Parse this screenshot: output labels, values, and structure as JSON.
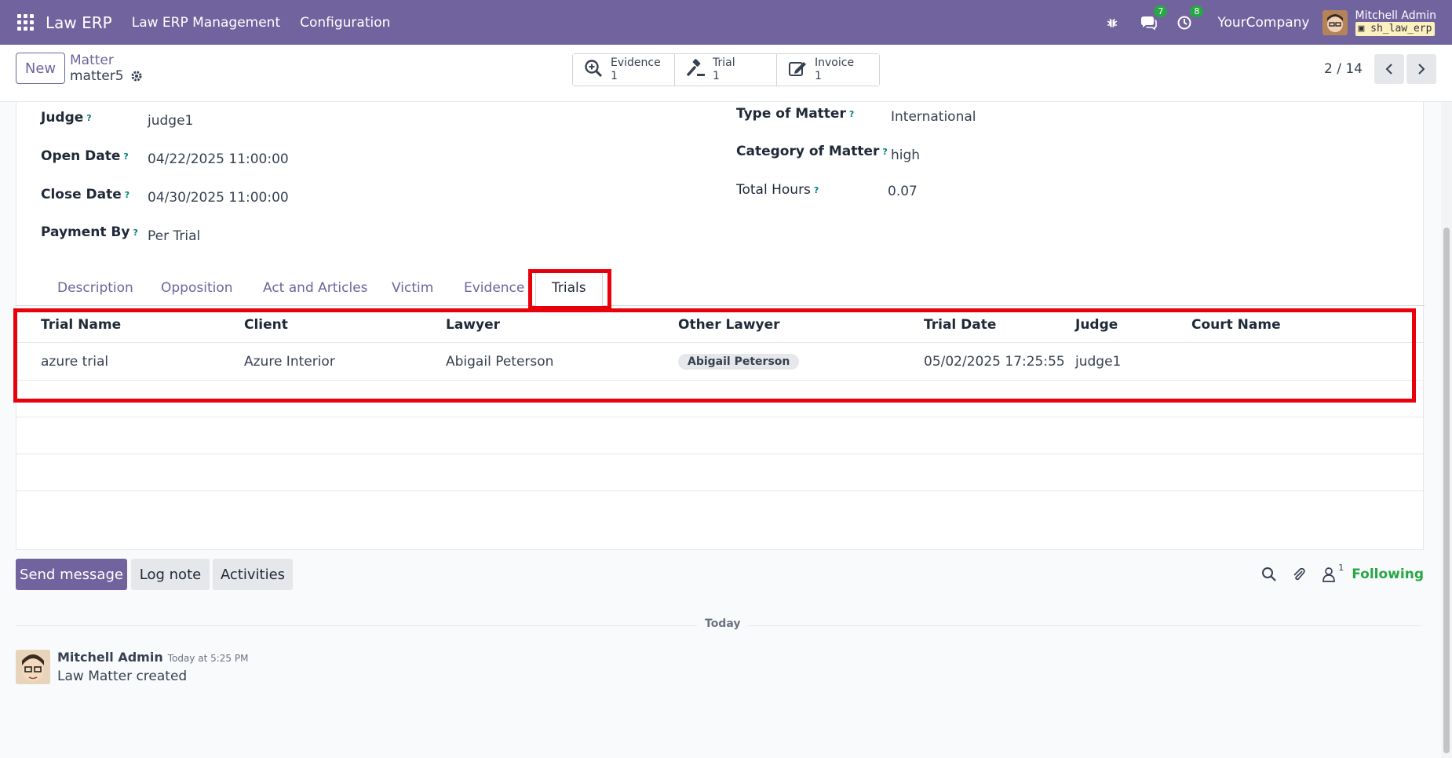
{
  "topbar": {
    "brand": "Law ERP",
    "menu": [
      "Law ERP Management",
      "Configuration"
    ],
    "messages_count": "7",
    "activities_count": "8",
    "company": "YourCompany",
    "user_name": "Mitchell Admin",
    "database": "sh_law_erp"
  },
  "control_panel": {
    "new_label": "New",
    "breadcrumb_parent": "Matter",
    "breadcrumb_current": "matter5",
    "smart_buttons": [
      {
        "label": "Evidence",
        "count": "1",
        "icon": "search-plus-icon"
      },
      {
        "label": "Trial",
        "count": "1",
        "icon": "gavel-icon"
      },
      {
        "label": "Invoice",
        "count": "1",
        "icon": "edit-icon"
      }
    ],
    "pager": "2 / 14"
  },
  "form": {
    "left_fields": [
      {
        "label": "Judge",
        "value": "judge1"
      },
      {
        "label": "Open Date",
        "value": "04/22/2025 11:00:00"
      },
      {
        "label": "Close Date",
        "value": "04/30/2025 11:00:00"
      },
      {
        "label": "Payment By",
        "value": "Per Trial"
      }
    ],
    "right_fields": [
      {
        "label": "Type of Matter",
        "value": "International"
      },
      {
        "label": "Category of Matter",
        "value": "high"
      },
      {
        "label": "Total Hours",
        "value": "0.07"
      }
    ],
    "help_mark": "?"
  },
  "tabs": [
    "Description",
    "Opposition",
    "Act and Articles",
    "Victim",
    "Evidence",
    "Trials"
  ],
  "trials_table": {
    "columns": [
      "Trial Name",
      "Client",
      "Lawyer",
      "Other Lawyer",
      "Trial Date",
      "Judge",
      "Court Name"
    ],
    "rows": [
      {
        "trial_name": "azure trial",
        "client": "Azure Interior",
        "lawyer": "Abigail Peterson",
        "other_lawyer": "Abigail Peterson",
        "trial_date": "05/02/2025 17:25:55",
        "judge": "judge1",
        "court_name": ""
      }
    ]
  },
  "chatter": {
    "send_message": "Send message",
    "log_note": "Log note",
    "activities": "Activities",
    "followers_count": "1",
    "following": "Following",
    "day_separator": "Today",
    "message": {
      "author": "Mitchell Admin",
      "time": "Today at 5:25 PM",
      "body": "Law Matter created"
    }
  },
  "colors": {
    "primary": "#71639e",
    "highlight": "#e8000b",
    "success": "#28a745"
  }
}
